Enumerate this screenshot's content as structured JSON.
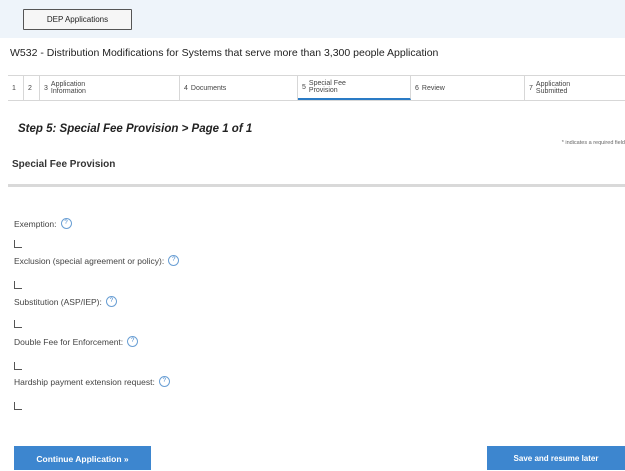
{
  "topbar": {
    "dep_applications_label": "DEP Applications"
  },
  "application": {
    "title": "W532 - Distribution Modifications for Systems that serve more than 3,300 people Application"
  },
  "steps": [
    {
      "num": "1",
      "label": ""
    },
    {
      "num": "2",
      "label": ""
    },
    {
      "num": "3",
      "label": "Application\nInformation"
    },
    {
      "num": "4",
      "label": "Documents"
    },
    {
      "num": "5",
      "label": "Special Fee\nProvision"
    },
    {
      "num": "6",
      "label": "Review"
    },
    {
      "num": "7",
      "label": "Application\nSubmitted"
    }
  ],
  "page": {
    "step_heading": "Step 5: Special Fee Provision > Page 1 of 1",
    "required_note": "* indicates a required field",
    "section_title": "Special Fee Provision"
  },
  "fields": [
    {
      "label": "Exemption:",
      "checked": false
    },
    {
      "label": "Exclusion (special agreement or policy):",
      "checked": false
    },
    {
      "label": "Substitution (ASP/IEP):",
      "checked": false
    },
    {
      "label": "Double Fee for Enforcement:",
      "checked": false
    },
    {
      "label": "Hardship payment extension request:",
      "checked": false
    }
  ],
  "help_glyph": "?",
  "icons": {
    "help": "help-circle-icon",
    "checkbox": "checkbox-icon"
  },
  "buttons": {
    "continue_label": "Continue Application »",
    "save_label": "Save and resume later"
  },
  "colors": {
    "accent": "#3d86cf",
    "topbar_bg": "#eef4fa"
  }
}
